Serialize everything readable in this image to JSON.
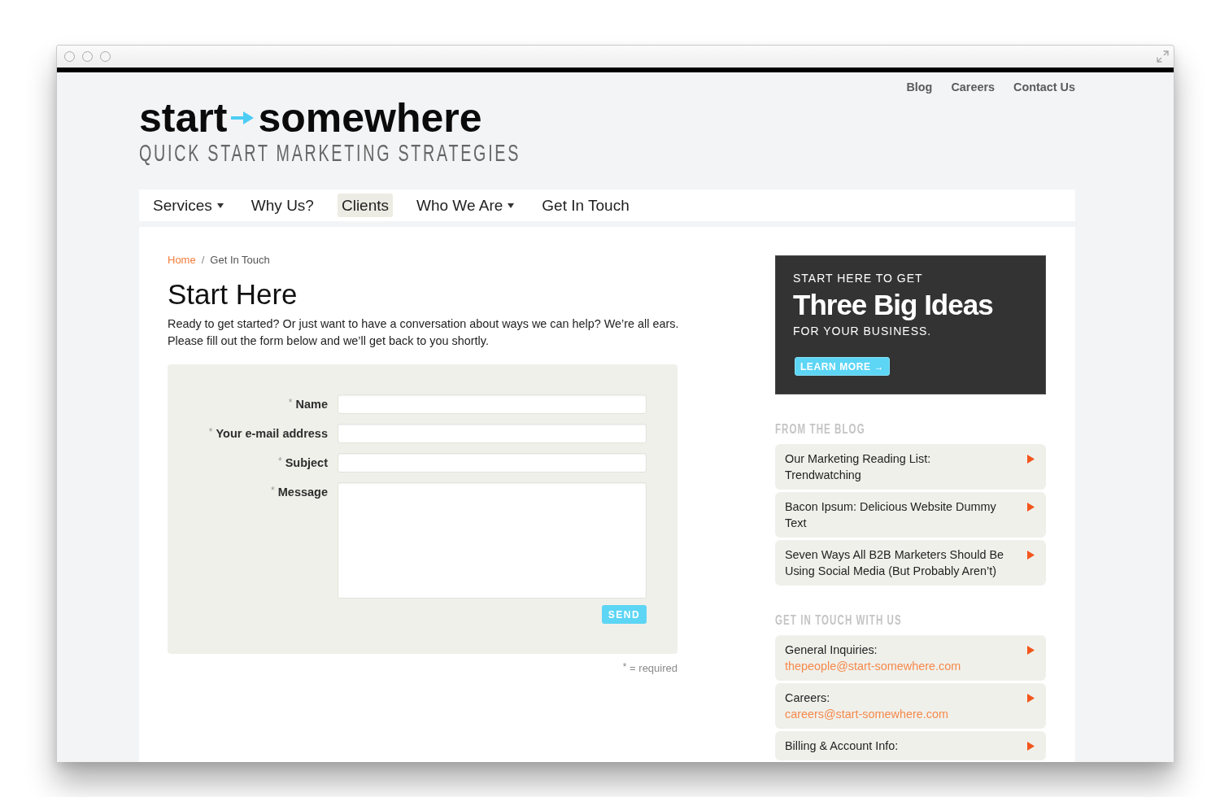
{
  "top_links": [
    {
      "label": "Blog"
    },
    {
      "label": "Careers"
    },
    {
      "label": "Contact Us"
    }
  ],
  "logo": {
    "word_1": "start",
    "word_2": "somewhere",
    "tagline": "QUICK START MARKETING STRATEGIES"
  },
  "nav": [
    {
      "label": "Services",
      "dropdown": true,
      "selected": false
    },
    {
      "label": "Why Us?",
      "dropdown": false,
      "selected": false
    },
    {
      "label": "Clients",
      "dropdown": false,
      "selected": true
    },
    {
      "label": "Who We Are",
      "dropdown": true,
      "selected": false
    },
    {
      "label": "Get In Touch",
      "dropdown": false,
      "selected": false
    }
  ],
  "breadcrumb": {
    "separator": "/",
    "items": [
      {
        "label": "Home",
        "link": true
      },
      {
        "label": "Get In Touch",
        "link": false
      }
    ]
  },
  "page": {
    "title": "Start Here",
    "intro": "Ready to get started? Or just want to have a conversation about ways we can help? We’re all ears. Please fill out the form below and we’ll get back to you shortly."
  },
  "form": {
    "fields": [
      {
        "kind": "input",
        "label": "Name",
        "required": true,
        "mark": "*"
      },
      {
        "kind": "input",
        "label": "Your e-mail address",
        "required": true,
        "mark": "*"
      },
      {
        "kind": "input",
        "label": "Subject",
        "required": true,
        "mark": "*"
      },
      {
        "kind": "textarea",
        "label": "Message",
        "required": true,
        "mark": "*"
      }
    ],
    "submit": "SEND",
    "note": {
      "mark": "*",
      "text": "= required"
    }
  },
  "promo": {
    "kicker": "START HERE TO GET",
    "headline": "Three Big Ideas",
    "subline": "FOR YOUR BUSINESS.",
    "button": "LEARN MORE →"
  },
  "sidebar": [
    {
      "kind": "posts",
      "heading": "FROM THE BLOG",
      "items": [
        {
          "title": "Our Marketing Reading List: Trendwatching"
        },
        {
          "title": "Bacon Ipsum: Delicious Website Dummy Text"
        },
        {
          "title": "Seven Ways All B2B Marketers Should Be Using Social Media (But Probably Aren’t)"
        }
      ]
    },
    {
      "kind": "contacts",
      "heading": "GET IN TOUCH WITH US",
      "items": [
        {
          "label": "General Inquiries:",
          "email": "thepeople@start-somewhere.com"
        },
        {
          "label": "Careers:",
          "email": "careers@start-somewhere.com"
        },
        {
          "label": "Billing & Account Info:"
        }
      ]
    }
  ]
}
